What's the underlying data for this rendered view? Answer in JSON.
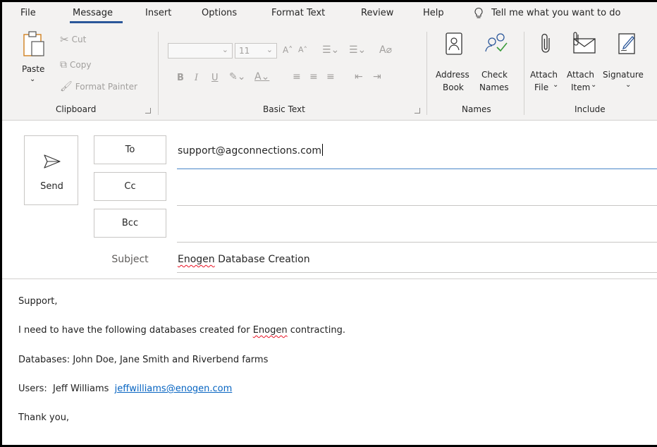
{
  "menu": {
    "tabs": [
      "File",
      "Message",
      "Insert",
      "Options",
      "Format Text",
      "Review",
      "Help"
    ],
    "active_tab": "Message",
    "tell_me": "Tell me what you want to do"
  },
  "ribbon": {
    "clipboard": {
      "paste": "Paste",
      "cut": "Cut",
      "copy": "Copy",
      "format_painter": "Format Painter",
      "label": "Clipboard"
    },
    "basic_text": {
      "font_size": "11",
      "bold": "B",
      "italic": "I",
      "underline": "U",
      "label": "Basic Text"
    },
    "names": {
      "address_book_1": "Address",
      "address_book_2": "Book",
      "check_names_1": "Check",
      "check_names_2": "Names",
      "label": "Names"
    },
    "include": {
      "attach_file_1": "Attach",
      "attach_file_2": "File",
      "attach_item_1": "Attach",
      "attach_item_2": "Item",
      "signature": "Signature",
      "label": "Include"
    }
  },
  "compose": {
    "send": "Send",
    "to_label": "To",
    "cc_label": "Cc",
    "bcc_label": "Bcc",
    "to_value": "support@agconnections.com",
    "cc_value": "",
    "bcc_value": "",
    "subject_label": "Subject",
    "subject_word1": "Enogen",
    "subject_rest": " Database Creation"
  },
  "body": {
    "greeting": "Support,",
    "line1_pre": "I need to have the following databases created for ",
    "line1_word": "Enogen",
    "line1_post": " contracting.",
    "line2": "Databases: John Doe, Jane Smith and Riverbend farms",
    "line3_pre": "Users:  Jeff Williams  ",
    "line3_email": "jeffwilliams@enogen.com",
    "closing": "Thank you,"
  },
  "colors": {
    "accent": "#2b579a",
    "link": "#0563c1",
    "ribbon_bg": "#f3f2f1",
    "field_focus": "#4a86c8"
  }
}
